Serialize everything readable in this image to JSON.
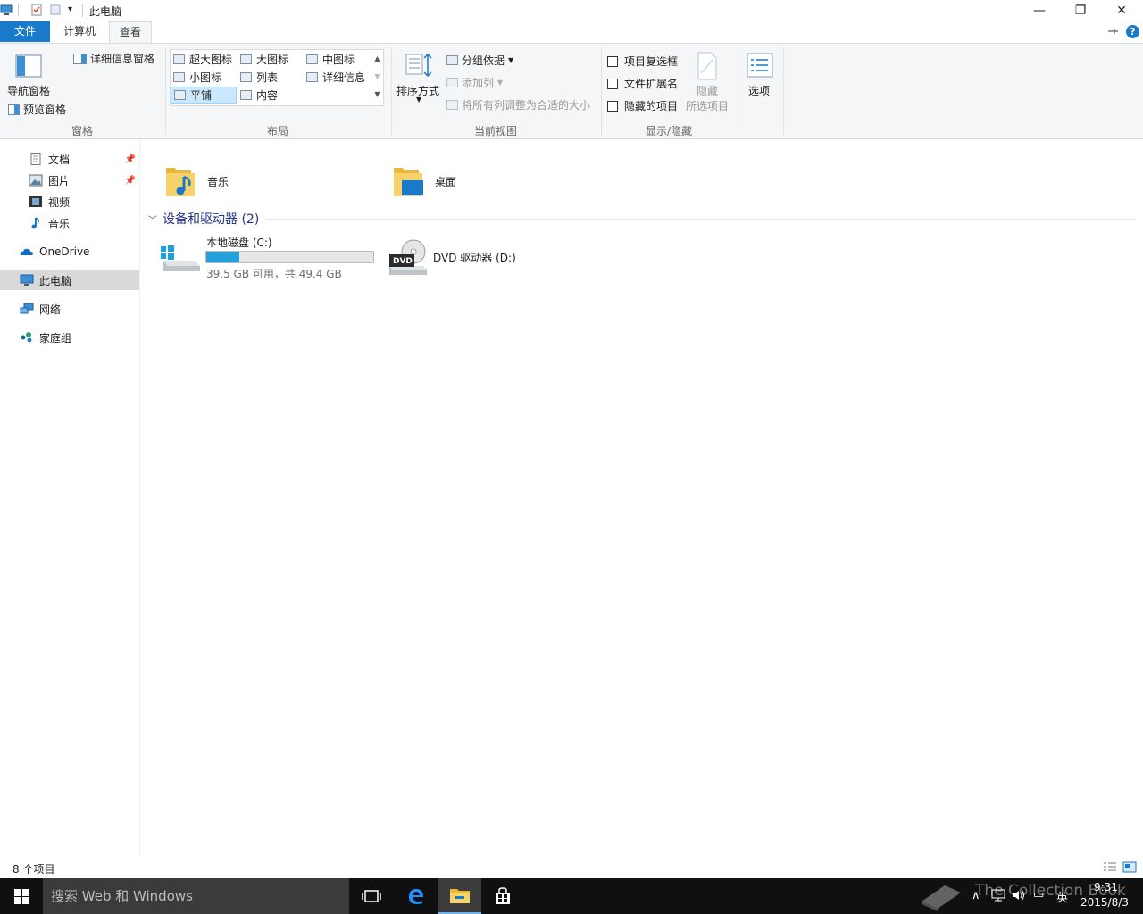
{
  "window": {
    "title": "此电脑",
    "quick_access_dropdown": "▾",
    "minimize": "—",
    "restore": "❐",
    "close": "✕"
  },
  "tabs": [
    {
      "label": "文件"
    },
    {
      "label": "计算机"
    },
    {
      "label": "查看"
    }
  ],
  "ribbon": {
    "panes": {
      "nav_pane": "导航窗格",
      "preview_pane": "预览窗格",
      "details_pane": "详细信息窗格",
      "group_label": "窗格"
    },
    "layout": {
      "items": [
        "超大图标",
        "大图标",
        "中图标",
        "小图标",
        "列表",
        "详细信息",
        "平铺",
        "内容"
      ],
      "selected": "平铺",
      "group_label": "布局"
    },
    "current_view": {
      "sort": "排序方式",
      "group_by": "分组依据",
      "add_column": "添加列",
      "fit_columns": "将所有列调整为合适的大小",
      "group_label": "当前视图"
    },
    "show_hide": {
      "item_checkboxes": "项目复选框",
      "file_extensions": "文件扩展名",
      "hidden_items": "隐藏的项目",
      "hide": "隐藏",
      "selected_items": "所选项目",
      "group_label": "显示/隐藏"
    },
    "options": "选项",
    "help": "?"
  },
  "nav": {
    "items": [
      {
        "label": "文档",
        "pinned": true
      },
      {
        "label": "图片",
        "pinned": true
      },
      {
        "label": "视频"
      },
      {
        "label": "音乐"
      },
      {
        "label": "OneDrive"
      },
      {
        "label": "此电脑",
        "selected": true
      },
      {
        "label": "网络"
      },
      {
        "label": "家庭组"
      }
    ]
  },
  "content": {
    "folders": [
      {
        "label": "音乐"
      },
      {
        "label": "桌面"
      }
    ],
    "devices_header": "设备和驱动器 (2)",
    "drives": [
      {
        "label": "本地磁盘 (C:)",
        "space": "39.5 GB 可用，共 49.4 GB",
        "used_fraction": 0.2
      },
      {
        "label": "DVD 驱动器 (D:)",
        "badge": "DVD"
      }
    ]
  },
  "status": {
    "count": "8 个项目"
  },
  "taskbar": {
    "search_placeholder": "搜索 Web 和 Windows",
    "time": "9:31",
    "date": "2015/8/3",
    "ime": "英",
    "watermark": "The Collection Book"
  },
  "colors": {
    "accent": "#1979ca",
    "drive_bar": "#26a0da",
    "taskbar": "#101010",
    "search_box": "#3b3b3b",
    "header_blue": "#1e3287"
  }
}
